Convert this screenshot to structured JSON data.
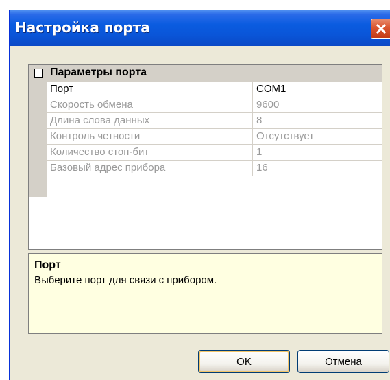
{
  "window": {
    "title": "Настройка порта"
  },
  "grid": {
    "category_label": "Параметры порта",
    "properties": [
      {
        "name": "Порт",
        "value": "COM1",
        "enabled": true
      },
      {
        "name": "Скорость обмена",
        "value": "9600",
        "enabled": false
      },
      {
        "name": "Длина слова данных",
        "value": "8",
        "enabled": false
      },
      {
        "name": "Контроль четности",
        "value": "Отсутствует",
        "enabled": false
      },
      {
        "name": "Количество стоп-бит",
        "value": "1",
        "enabled": false
      },
      {
        "name": "Базовый адрес прибора",
        "value": "16",
        "enabled": false
      }
    ]
  },
  "help": {
    "title": "Порт",
    "description": "Выберите порт для связи с прибором."
  },
  "buttons": {
    "ok_label": "OK",
    "cancel_label": "Отмена"
  },
  "icons": {
    "close": "close-icon",
    "expander": "collapse-icon"
  },
  "colors": {
    "titlebar": "#0A55D8",
    "window_bg": "#ECE9D8",
    "close_button": "#D9552F",
    "help_bg": "#FFFFE1",
    "disabled_text": "#9A9A9A"
  }
}
